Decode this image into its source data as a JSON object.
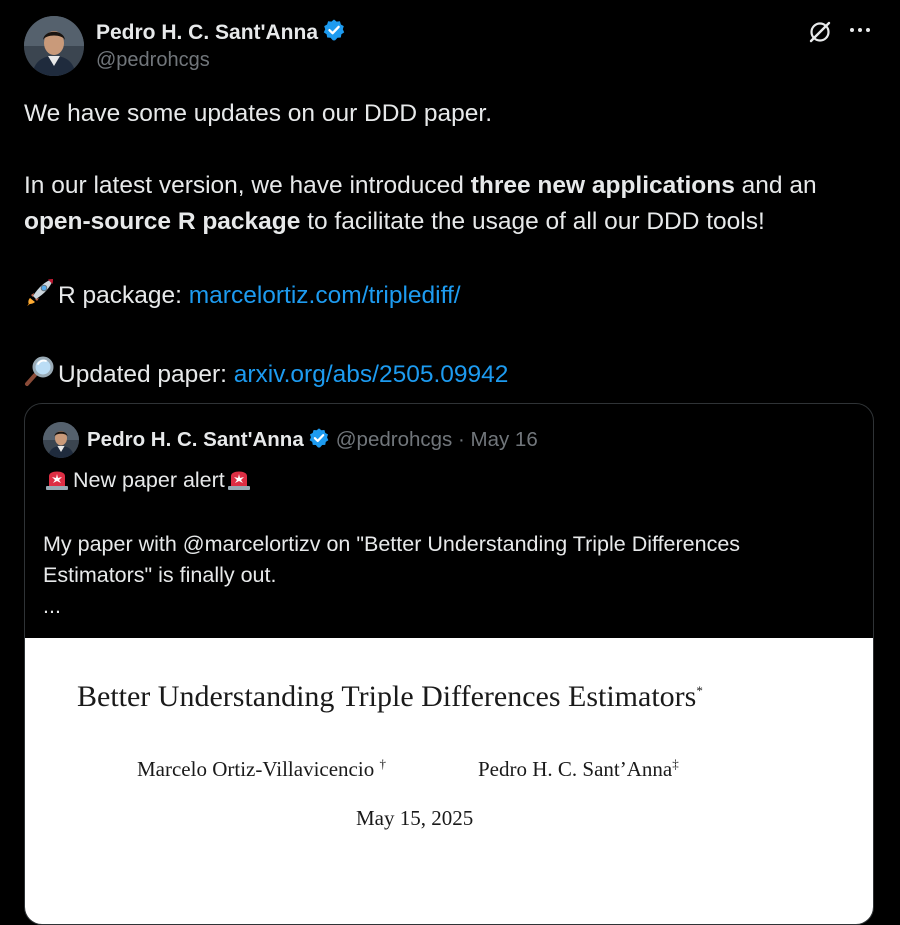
{
  "author": {
    "name": "Pedro H. C. Sant'Anna",
    "handle": "@pedrohcgs"
  },
  "icons": {
    "verified": "verified-badge-icon",
    "grok": "grok-icon",
    "more": "more-icon",
    "rocket": "rocket-emoji",
    "magnifier": "magnifying-glass-emoji",
    "siren": "siren-emoji"
  },
  "colors": {
    "accent": "#1d9bf0",
    "muted": "#71767b",
    "text": "#e7e9ea",
    "background": "#000000"
  },
  "tweet": {
    "line1": "We have some updates on our DDD paper.",
    "p2_a": "In our latest version, we have introduced ",
    "p2_b": "three new applications",
    "p2_c": " and an ",
    "p2_d": "open-source R package",
    "p2_e": " to facilitate the usage of all our DDD tools!",
    "pkg_label": "R package: ",
    "pkg_link": "marcelortiz.com/triplediff/",
    "paper_label": "Updated paper: ",
    "paper_link": "arxiv.org/abs/2505.09942"
  },
  "quote": {
    "name": "Pedro H. C. Sant'Anna",
    "meta": "@pedrohcgs · May 16",
    "alert": "New paper alert",
    "body": "My paper with @marcelortizv on \"Better Understanding Triple Differences Estimators\" is finally out.",
    "ellipsis": "..."
  },
  "paper": {
    "title": "Better Understanding Triple Differences Estimators",
    "title_mark": "*",
    "author1": "Marcelo Ortiz-Villavicencio",
    "author1_mark": "†",
    "author2": "Pedro H. C. Sant’Anna",
    "author2_mark": "‡",
    "date": "May 15, 2025"
  }
}
